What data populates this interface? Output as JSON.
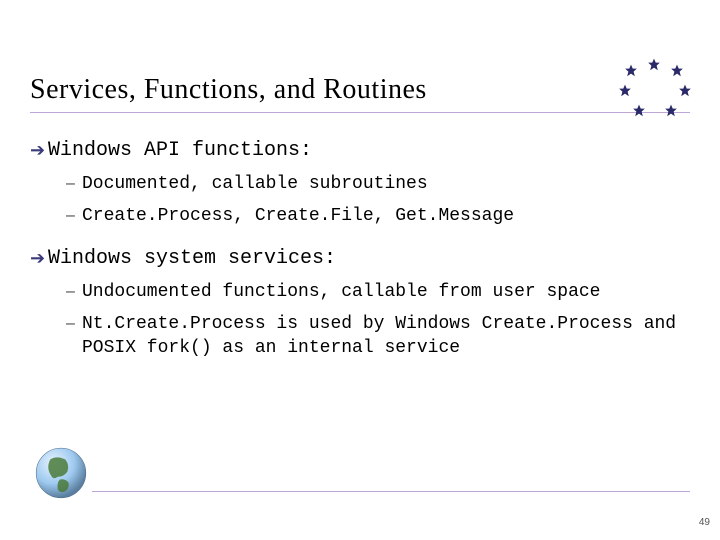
{
  "title": "Services, Functions, and Routines",
  "bullets": [
    {
      "text": "Windows API functions:",
      "sub": [
        "Documented, callable subroutines",
        "Create.Process, Create.File, Get.Message"
      ]
    },
    {
      "text": "Windows system services:",
      "sub": [
        "Undocumented functions, callable from user space",
        "Nt.Create.Process is used by Windows Create.Process and POSIX fork() as an internal service"
      ]
    }
  ],
  "page_number": "49"
}
